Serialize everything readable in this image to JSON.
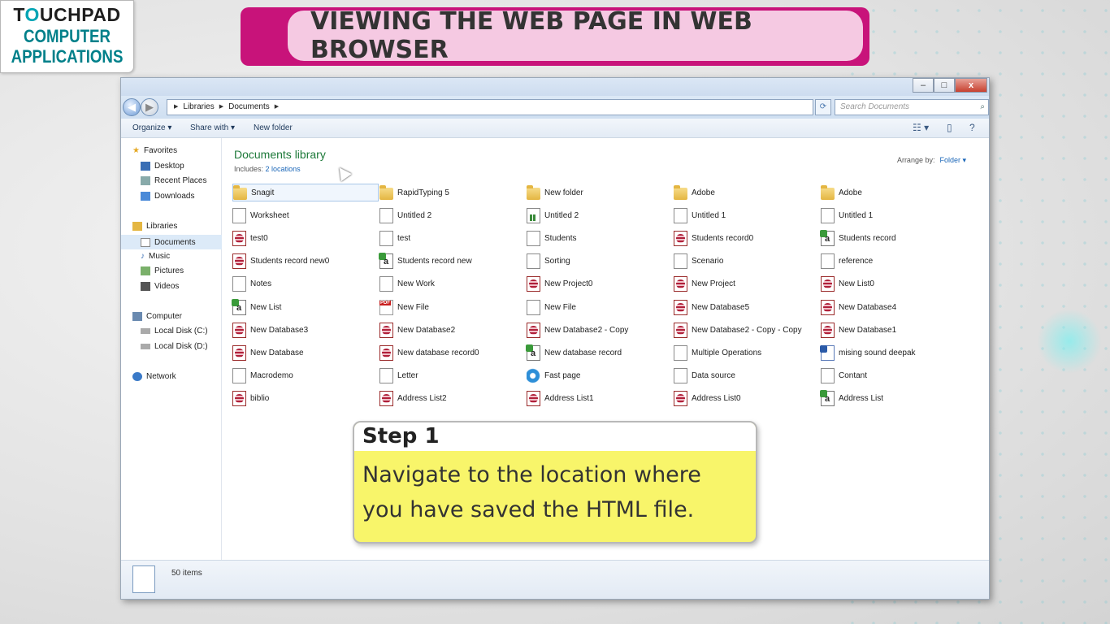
{
  "logo": {
    "brand_pre": "T",
    "brand_o": "O",
    "brand_post": "UCHPAD",
    "line1": "COMPUTER",
    "line2": "APPLICATIONS"
  },
  "banner": {
    "title": "VIEWING THE WEB PAGE IN WEB BROWSER"
  },
  "window": {
    "controls": {
      "minimize": "–",
      "maximize": "□",
      "close": "x"
    },
    "address": {
      "crumbs": [
        "Libraries",
        "Documents"
      ]
    },
    "search": {
      "placeholder": "Search Documents"
    },
    "toolbar": {
      "organize": "Organize ▾",
      "share_with": "Share with ▾",
      "new_folder": "New folder"
    },
    "sidebar": {
      "favorites": "Favorites",
      "desktop": "Desktop",
      "recent_places": "Recent Places",
      "downloads": "Downloads",
      "libraries": "Libraries",
      "documents": "Documents",
      "music": "Music",
      "pictures": "Pictures",
      "videos": "Videos",
      "computer": "Computer",
      "local_c": "Local Disk (C:)",
      "local_d": "Local Disk (D:)",
      "network": "Network"
    },
    "library": {
      "title": "Documents library",
      "includes_label": "Includes:",
      "includes_link": "2 locations",
      "arrange_label": "Arrange by:",
      "arrange_value": "Folder ▾"
    },
    "files": [
      [
        {
          "name": "Snagit",
          "icon": "folder"
        },
        {
          "name": "Worksheet",
          "icon": "doc"
        },
        {
          "name": "test0",
          "icon": "access"
        },
        {
          "name": "Students record new0",
          "icon": "access"
        },
        {
          "name": "Notes",
          "icon": "doc"
        },
        {
          "name": "New List",
          "icon": "excel"
        },
        {
          "name": "New Database3",
          "icon": "access"
        },
        {
          "name": "New Database",
          "icon": "access"
        },
        {
          "name": "Macrodemo",
          "icon": "doc"
        },
        {
          "name": "biblio",
          "icon": "access"
        }
      ],
      [
        {
          "name": "RapidTyping 5",
          "icon": "folder"
        },
        {
          "name": "Untitled 2",
          "icon": "doc"
        },
        {
          "name": "test",
          "icon": "doc"
        },
        {
          "name": "Students record new",
          "icon": "excel"
        },
        {
          "name": "New Work",
          "icon": "doc"
        },
        {
          "name": "New File",
          "icon": "pdf"
        },
        {
          "name": "New Database2",
          "icon": "access"
        },
        {
          "name": "New database record0",
          "icon": "access"
        },
        {
          "name": "Letter",
          "icon": "doc"
        },
        {
          "name": "Address List2",
          "icon": "access"
        }
      ],
      [
        {
          "name": "New folder",
          "icon": "folder"
        },
        {
          "name": "Untitled 2",
          "icon": "chart"
        },
        {
          "name": "Students",
          "icon": "doc"
        },
        {
          "name": "Sorting",
          "icon": "doc"
        },
        {
          "name": "New Project0",
          "icon": "access"
        },
        {
          "name": "New File",
          "icon": "doc"
        },
        {
          "name": "New Database2 - Copy",
          "icon": "access"
        },
        {
          "name": "New database record",
          "icon": "excel"
        },
        {
          "name": "Fast page",
          "icon": "ie"
        },
        {
          "name": "Address List1",
          "icon": "access"
        }
      ],
      [
        {
          "name": "Adobe",
          "icon": "folder"
        },
        {
          "name": "Untitled 1",
          "icon": "doc"
        },
        {
          "name": "Students record0",
          "icon": "access"
        },
        {
          "name": "Scenario",
          "icon": "doc"
        },
        {
          "name": "New Project",
          "icon": "access"
        },
        {
          "name": "New Database5",
          "icon": "access"
        },
        {
          "name": "New Database2 - Copy - Copy",
          "icon": "access"
        },
        {
          "name": "Multiple Operations",
          "icon": "doc"
        },
        {
          "name": "Data source",
          "icon": "doc"
        },
        {
          "name": "Address List0",
          "icon": "access"
        }
      ],
      [
        {
          "name": "Adobe",
          "icon": "folder"
        },
        {
          "name": "Untitled 1",
          "icon": "doc"
        },
        {
          "name": "Students record",
          "icon": "excel"
        },
        {
          "name": "reference",
          "icon": "doc"
        },
        {
          "name": "New List0",
          "icon": "access"
        },
        {
          "name": "New Database4",
          "icon": "access"
        },
        {
          "name": "New Database1",
          "icon": "access"
        },
        {
          "name": "mising sound deepak",
          "icon": "word"
        },
        {
          "name": "Contant",
          "icon": "doc"
        },
        {
          "name": "Address List",
          "icon": "excel"
        }
      ]
    ],
    "status": {
      "count": "50 items"
    }
  },
  "step": {
    "heading": "Step 1",
    "line1": "Navigate to the location where",
    "line2": "you have saved the HTML file."
  }
}
